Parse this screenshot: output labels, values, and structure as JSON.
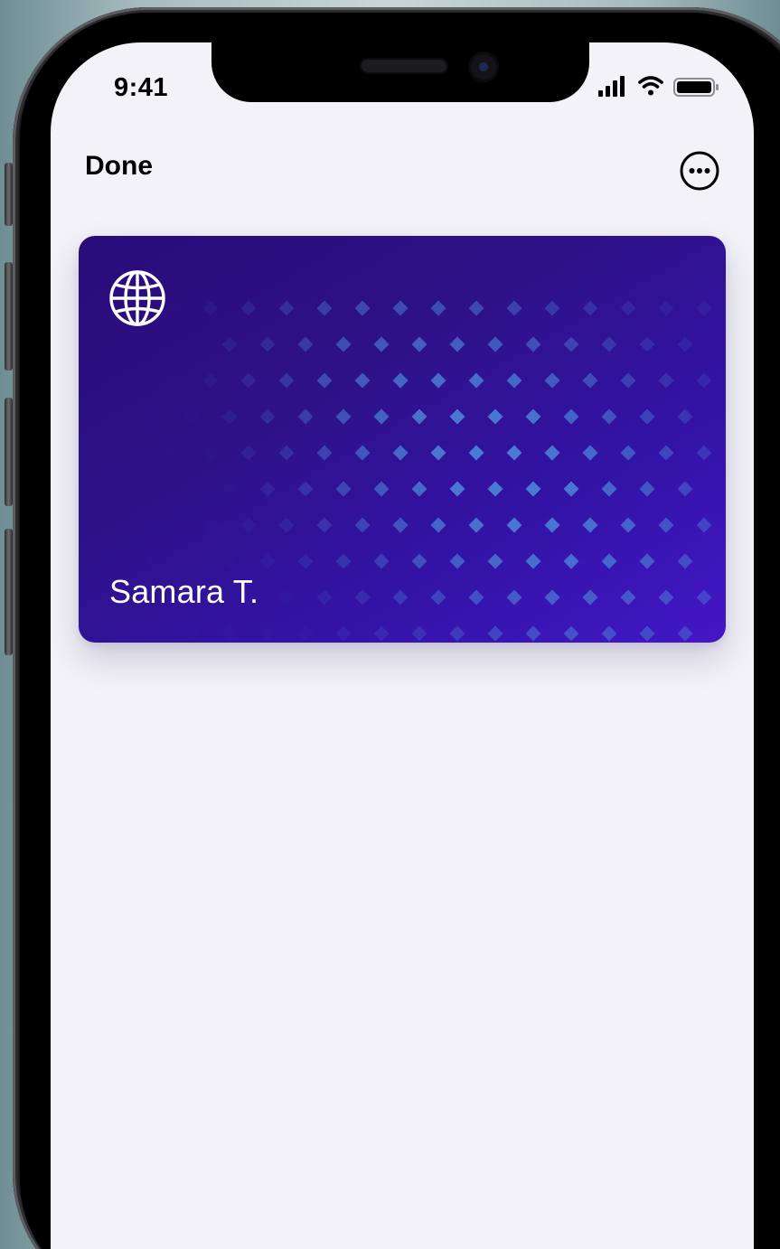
{
  "status_bar": {
    "time": "9:41",
    "signal_icon": "cellular-signal-icon",
    "wifi_icon": "wifi-icon",
    "battery_icon": "battery-icon"
  },
  "nav": {
    "done_label": "Done",
    "more_icon": "ellipsis-circle-icon"
  },
  "card": {
    "holder_name": "Samara T.",
    "logo_icon": "globe-icon",
    "colors": {
      "start": "#2a0b7a",
      "end": "#4317c6",
      "pattern": "#4a7fd6"
    }
  },
  "colors": {
    "screen_background": "#f2f2f7",
    "text": "#000000"
  }
}
